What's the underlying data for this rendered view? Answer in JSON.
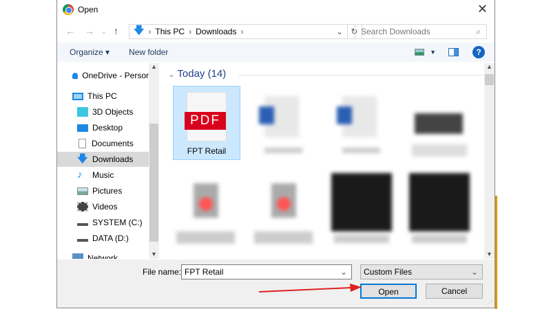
{
  "window": {
    "title": "Open",
    "close": "✕"
  },
  "address": {
    "path": [
      "This PC",
      "Downloads"
    ],
    "search_placeholder": "Search Downloads"
  },
  "toolbar": {
    "organize": "Organize ▾",
    "new_folder": "New folder",
    "help": "?"
  },
  "nav": {
    "items": [
      {
        "label": "OneDrive - Persor",
        "icon": "cloud-icon"
      },
      {
        "label": "This PC",
        "icon": "computer-icon"
      },
      {
        "label": "3D Objects",
        "icon": "cube-icon"
      },
      {
        "label": "Desktop",
        "icon": "desktop-icon"
      },
      {
        "label": "Documents",
        "icon": "document-icon"
      },
      {
        "label": "Downloads",
        "icon": "download-icon",
        "selected": true
      },
      {
        "label": "Music",
        "icon": "music-icon"
      },
      {
        "label": "Pictures",
        "icon": "pictures-icon"
      },
      {
        "label": "Videos",
        "icon": "videos-icon"
      },
      {
        "label": "SYSTEM (C:)",
        "icon": "drive-icon"
      },
      {
        "label": "DATA (D:)",
        "icon": "drive-icon"
      },
      {
        "label": "Network",
        "icon": "network-icon"
      }
    ]
  },
  "files": {
    "group": "Today (14)",
    "selected_name": "FPT Retail",
    "pdf_label": "PDF"
  },
  "bottom": {
    "file_name_label": "File name:",
    "file_name_value": "FPT Retail",
    "file_type": "Custom Files",
    "open": "Open",
    "cancel": "Cancel"
  },
  "colors": {
    "accent": "#0078d7",
    "arrow": "#e02020",
    "pdf": "#d9001b"
  }
}
